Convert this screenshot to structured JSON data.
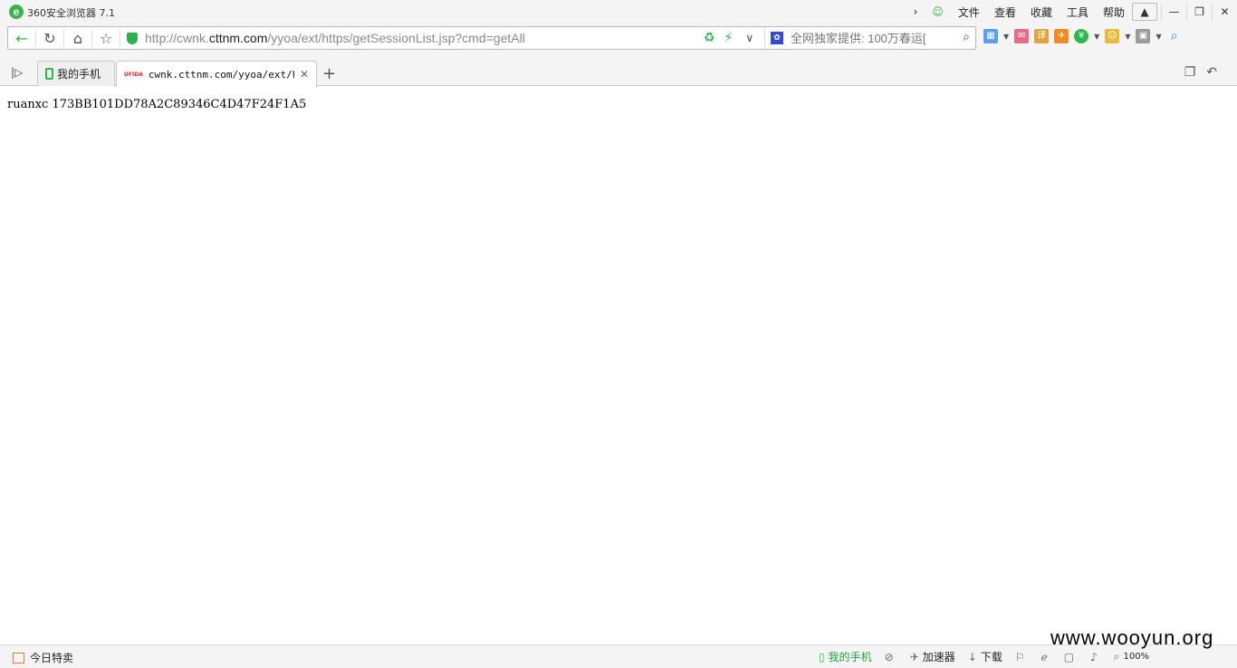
{
  "window": {
    "title": "360安全浏览器 7.1",
    "menu": [
      "文件",
      "查看",
      "收藏",
      "工具",
      "帮助"
    ]
  },
  "address": {
    "url_prefix": "http://cwnk.",
    "url_host": "cttnm.com",
    "url_path": "/yyoa/ext/https/getSessionList.jsp?cmd=getAll"
  },
  "search": {
    "placeholder": "全网独家提供: 100万春运[",
    "engine_icon": "baidu-icon"
  },
  "tabs": [
    {
      "label": "我的手机",
      "icon": "phone-icon"
    },
    {
      "label": "cwnk.cttnm.com/yyoa/ext/https",
      "favicon": "UFIDA",
      "active": true
    }
  ],
  "content": {
    "text": "ruanxc 173BB101DD78A2C89346C4D47F24F1A5"
  },
  "statusbar": {
    "deals": "今日特卖",
    "my_phone": "我的手机",
    "accelerator": "加速器",
    "download": "下载",
    "zoom": "100%"
  },
  "watermark": "www.wooyun.org",
  "colors": {
    "accent_green": "#2db84c",
    "chrome_bg": "#f4f4f4"
  }
}
